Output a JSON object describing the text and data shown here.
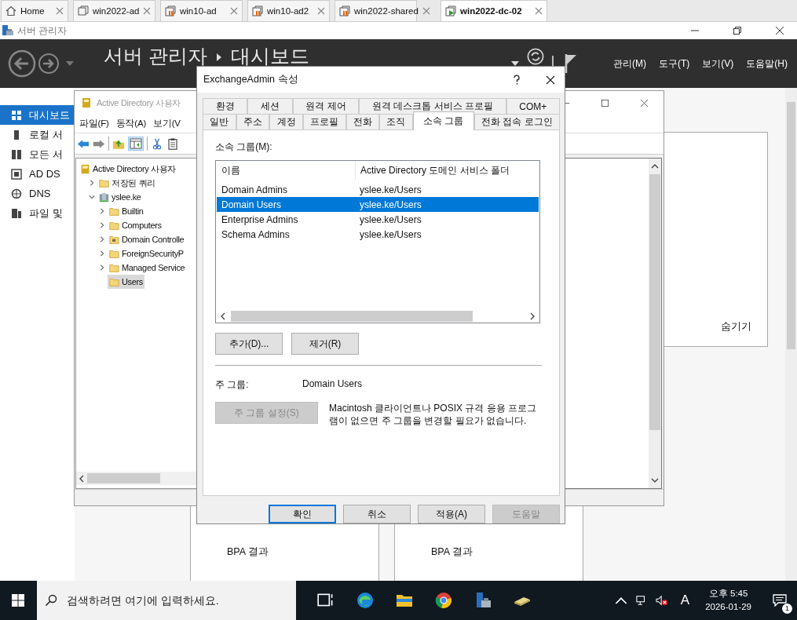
{
  "browser_tabs": [
    {
      "label": "Home",
      "kind": "home",
      "selected": false
    },
    {
      "label": "win2022-ad",
      "kind": "vm",
      "selected": false
    },
    {
      "label": "win10-ad",
      "kind": "vm-paused",
      "selected": false
    },
    {
      "label": "win10-ad2",
      "kind": "vm-paused",
      "selected": false
    },
    {
      "label": "win2022-shared",
      "kind": "vm-paused",
      "selected": false
    },
    {
      "label": "win2022-dc-02",
      "kind": "vm-running",
      "selected": true
    }
  ],
  "server_manager": {
    "title": "서버 관리자",
    "breadcrumb": [
      "서버 관리자",
      "대시보드"
    ],
    "menus": [
      "관리(M)",
      "도구(T)",
      "보기(V)",
      "도움말(H)"
    ],
    "sidebar": [
      {
        "label": "대시보드",
        "kind": "dashboard",
        "selected": true
      },
      {
        "label": "로컬 서",
        "kind": "server",
        "selected": false
      },
      {
        "label": "모든 서",
        "kind": "servers",
        "selected": false
      },
      {
        "label": "AD DS",
        "kind": "adds",
        "selected": false
      },
      {
        "label": "DNS",
        "kind": "dns",
        "selected": false
      },
      {
        "label": "파일 및",
        "kind": "files",
        "selected": false
      }
    ],
    "hide_link": "숨기기",
    "tiles": [
      {
        "item": "BPA 결과"
      },
      {
        "item": "BPA 결과"
      }
    ]
  },
  "ad_window": {
    "title": "Active Directory 사용자",
    "menus": [
      "파일(F)",
      "동작(A)",
      "보기(V"
    ],
    "tree": [
      {
        "label": "Active Directory 사용자",
        "kind": "root",
        "selected": false,
        "children": [
          {
            "label": "저장된 쿼리",
            "kind": "folder",
            "selected": false,
            "expanded": false
          },
          {
            "label": "yslee.ke",
            "kind": "domain",
            "selected": false,
            "expanded": true,
            "children": [
              {
                "label": "Builtin",
                "kind": "folder",
                "selected": false,
                "expanded": false
              },
              {
                "label": "Computers",
                "kind": "folder",
                "selected": false,
                "expanded": false
              },
              {
                "label": "Domain Controlle",
                "kind": "ou",
                "selected": false,
                "expanded": false
              },
              {
                "label": "ForeignSecurityP",
                "kind": "folder",
                "selected": false,
                "expanded": false
              },
              {
                "label": "Managed Service",
                "kind": "folder",
                "selected": false,
                "expanded": false
              },
              {
                "label": "Users",
                "kind": "folder",
                "selected": true
              }
            ]
          }
        ]
      }
    ]
  },
  "dialog": {
    "title": "ExchangeAdmin 속성",
    "tab_rows": [
      [
        {
          "label": "환경",
          "selected": false
        },
        {
          "label": "세션",
          "selected": false
        },
        {
          "label": "원격 제어",
          "selected": false
        },
        {
          "label": "원격 데스크톱 서비스 프로필",
          "selected": false
        },
        {
          "label": "COM+",
          "selected": false
        }
      ],
      [
        {
          "label": "일반",
          "selected": false
        },
        {
          "label": "주소",
          "selected": false
        },
        {
          "label": "계정",
          "selected": false
        },
        {
          "label": "프로필",
          "selected": false
        },
        {
          "label": "전화",
          "selected": false
        },
        {
          "label": "조직",
          "selected": false
        },
        {
          "label": "소속 그룹",
          "selected": true
        },
        {
          "label": "전화 접속 로그인",
          "selected": false
        }
      ]
    ],
    "group_label": "소속 그룹(M):",
    "columns": [
      "이름",
      "Active Directory 도메인 서비스 폴더"
    ],
    "rows": [
      {
        "name": "Domain Admins",
        "folder": "yslee.ke/Users",
        "selected": false
      },
      {
        "name": "Domain Users",
        "folder": "yslee.ke/Users",
        "selected": true
      },
      {
        "name": "Enterprise Admins",
        "folder": "yslee.ke/Users",
        "selected": false
      },
      {
        "name": "Schema Admins",
        "folder": "yslee.ke/Users",
        "selected": false
      }
    ],
    "add_button": "추가(D)...",
    "remove_button": "제거(R)",
    "primary_label": "주 그룹:",
    "primary_value": "Domain Users",
    "set_primary": {
      "label": "주 그룹 설정(S)",
      "disabled": true
    },
    "note": "Macintosh 클라이언트나 POSIX 규격 응용 프로그램이 없으면 주 그룹을 변경할 필요가 없습니다.",
    "buttons": [
      {
        "label": "확인",
        "kind": "default",
        "disabled": false
      },
      {
        "label": "취소",
        "kind": "normal",
        "disabled": false
      },
      {
        "label": "적용(A)",
        "kind": "normal",
        "disabled": false
      },
      {
        "label": "도움말",
        "kind": "normal",
        "disabled": true
      }
    ]
  },
  "taskbar": {
    "search": {
      "placeholder": "검색하려면 여기에 입력하세요."
    },
    "ime": "A",
    "time": "오후 5:45",
    "date": "2026-01-29",
    "notifications": "1"
  }
}
